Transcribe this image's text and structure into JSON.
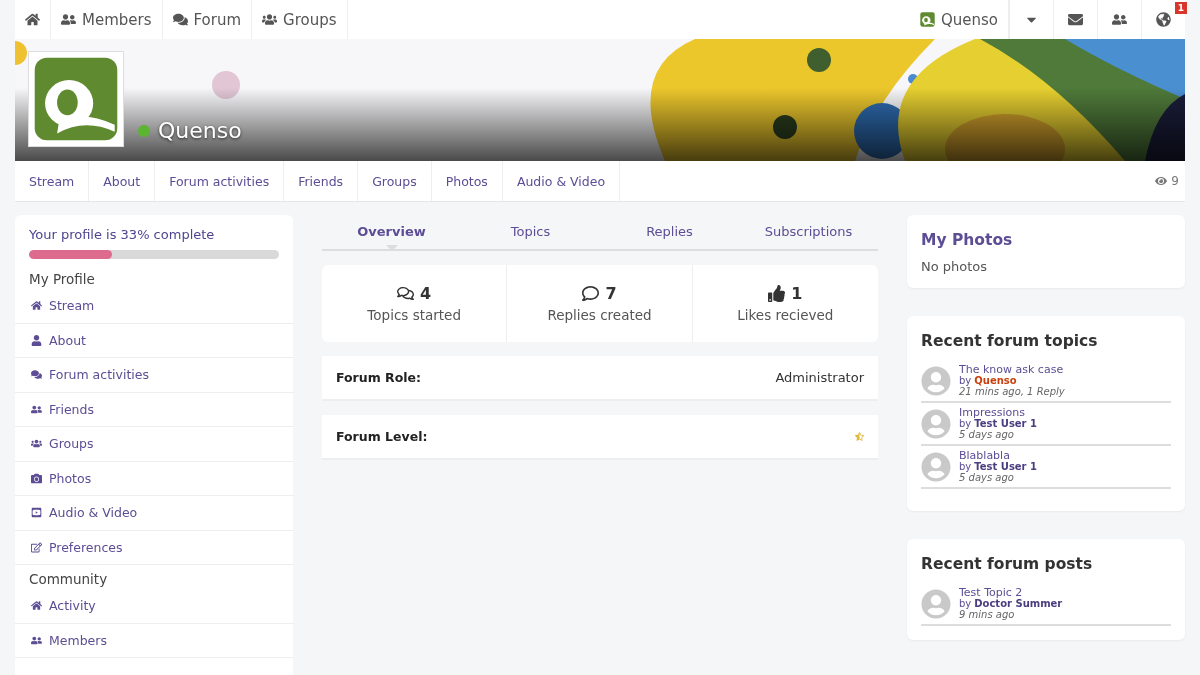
{
  "top_nav": {
    "left": [
      {
        "kind": "home"
      },
      {
        "kind": "members",
        "label": "Members"
      },
      {
        "kind": "forum",
        "label": "Forum"
      },
      {
        "kind": "groups",
        "label": "Groups"
      }
    ],
    "user": "Quenso",
    "notification_count": "1"
  },
  "profile": {
    "name": "Quenso",
    "online": true,
    "views": "9",
    "tabs": [
      {
        "label": "Stream",
        "selected": false
      },
      {
        "label": "About",
        "selected": false
      },
      {
        "label": "Forum activities",
        "selected": false
      },
      {
        "label": "Friends",
        "selected": false
      },
      {
        "label": "Groups",
        "selected": false
      },
      {
        "label": "Photos",
        "selected": false
      },
      {
        "label": "Audio & Video",
        "selected": false
      }
    ]
  },
  "sidebar": {
    "completion_text": "Your profile is 33% complete",
    "level": 0.33,
    "sections": [
      {
        "title": "My Profile",
        "items": [
          {
            "kind": "home",
            "label": "Stream"
          },
          {
            "kind": "user",
            "label": "About"
          },
          {
            "kind": "forum",
            "label": "Forum activities"
          },
          {
            "kind": "members",
            "label": "Friends"
          },
          {
            "kind": "groups",
            "label": "Groups"
          },
          {
            "kind": "camera",
            "label": "Photos"
          },
          {
            "kind": "video",
            "label": "Audio & Video"
          },
          {
            "kind": "edit",
            "label": "Preferences"
          }
        ]
      },
      {
        "title": "Community",
        "items": [
          {
            "kind": "home",
            "label": "Activity"
          },
          {
            "kind": "members",
            "label": "Members"
          }
        ]
      }
    ]
  },
  "forum_tabs": [
    {
      "label": "Overview",
      "selected": true
    },
    {
      "label": "Topics",
      "selected": false
    },
    {
      "label": "Replies",
      "selected": false
    },
    {
      "label": "Subscriptions",
      "selected": false
    }
  ],
  "stats": [
    {
      "kind": "topics",
      "value": "4",
      "label": "Topics started"
    },
    {
      "kind": "replies",
      "value": "7",
      "label": "Replies created"
    },
    {
      "kind": "likes",
      "value": "1",
      "label": "Likes recieved"
    }
  ],
  "forum_role": {
    "label": "Forum Role:",
    "value": "Administrator"
  },
  "forum_level": {
    "label": "Forum Level:"
  },
  "my_photos": {
    "title": "My Photos",
    "empty_text": "No photos"
  },
  "recent_topics": {
    "title": "Recent forum topics",
    "items": [
      {
        "title": "The know ask case",
        "by": "by",
        "author": "Quenso",
        "color": "#c8400e",
        "meta": "21 mins ago, 1 Reply"
      },
      {
        "title": "Impressions",
        "by": "by",
        "author": "Test User 1",
        "color": "#4a3d80",
        "meta": "5 days ago"
      },
      {
        "title": "Blablabla",
        "by": "by",
        "author": "Test User 1",
        "color": "#4a3d80",
        "meta": "5 days ago"
      }
    ]
  },
  "recent_posts": {
    "title": "Recent forum posts",
    "items": [
      {
        "title": "Test Topic 2",
        "by": "by",
        "author": "Doctor Summer",
        "color": "#4a3d80",
        "meta": "9 mins ago"
      }
    ]
  }
}
